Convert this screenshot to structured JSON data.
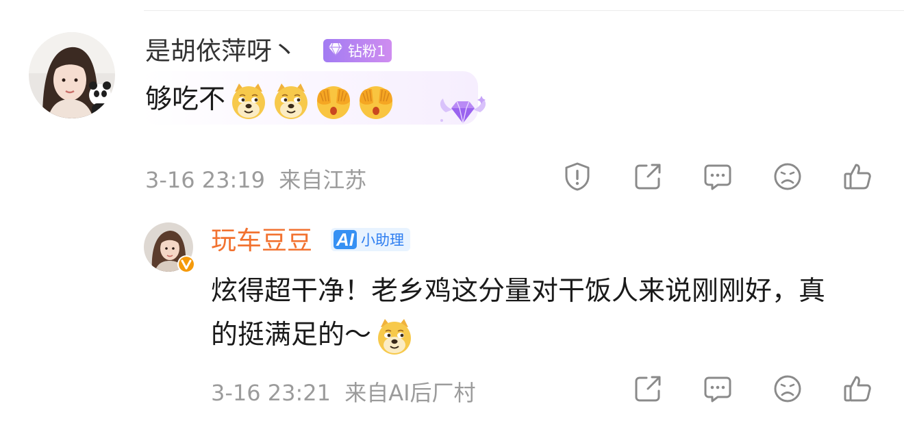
{
  "comment": {
    "username": "是胡依萍呀丶",
    "badge": "钻粉1",
    "text": "够吃不",
    "emojis": [
      "doge-emoji",
      "doge-emoji",
      "cover-eyes-emoji",
      "cover-eyes-emoji"
    ],
    "time": "3-16 23:19",
    "location": "来自江苏",
    "actions": [
      "report-icon",
      "share-icon",
      "comment-icon",
      "dislike-icon",
      "like-icon"
    ]
  },
  "reply": {
    "username": "玩车豆豆",
    "badge_mark": "AI",
    "badge": "小助理",
    "text": "炫得超干净！老乡鸡这分量对干饭人来说刚刚好，真的挺满足的～",
    "emojis": [
      "doge-emoji"
    ],
    "time": "3-16 23:21",
    "location": "来自AI后厂村",
    "actions": [
      "share-icon",
      "comment-icon",
      "dislike-icon",
      "like-icon"
    ]
  },
  "colors": {
    "reply_name": "#f27230",
    "meta_text": "#9b9b9b",
    "fan_badge": "#a27bf2",
    "ai_badge": "#3590f3",
    "verified_badge": "#f59a0b"
  }
}
